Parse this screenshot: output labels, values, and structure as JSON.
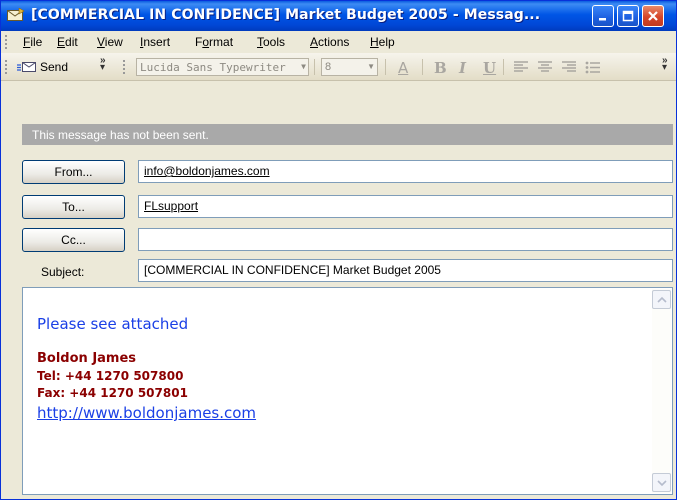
{
  "window": {
    "title": "[COMMERCIAL IN CONFIDENCE] Market Budget 2005 - Messag...",
    "accent_color": "#0054e3"
  },
  "menu": [
    {
      "label": "File",
      "mnemonic": "F"
    },
    {
      "label": "Edit",
      "mnemonic": "E"
    },
    {
      "label": "View",
      "mnemonic": "V"
    },
    {
      "label": "Insert",
      "mnemonic": "I"
    },
    {
      "label": "Format",
      "mnemonic": "o"
    },
    {
      "label": "Tools",
      "mnemonic": "T"
    },
    {
      "label": "Actions",
      "mnemonic": "A"
    },
    {
      "label": "Help",
      "mnemonic": "H"
    }
  ],
  "toolbar": {
    "send_label": "Send",
    "font_name": "Lucida Sans Typewriter",
    "font_size": "8",
    "format_buttons": [
      "A",
      "B",
      "I",
      "U"
    ]
  },
  "info_bar": {
    "text": "This message has not been sent."
  },
  "address": {
    "from_button": "From...",
    "from_value": "info@boldonjames.com",
    "to_button": "To...",
    "to_value": "FLsupport",
    "cc_button": "Cc...",
    "cc_value": "",
    "subject_label": "Subject:",
    "subject_value": "[COMMERCIAL IN CONFIDENCE] Market Budget 2005"
  },
  "body": {
    "greeting": "Please see attached",
    "signature_name": "Boldon James",
    "signature_tel": "Tel: +44 1270 507800",
    "signature_fax": "Fax: +44 1270 507801",
    "signature_link": "http://www.boldonjames.com",
    "greeting_color": "#1a3fe6",
    "signature_color": "#8b0000"
  }
}
